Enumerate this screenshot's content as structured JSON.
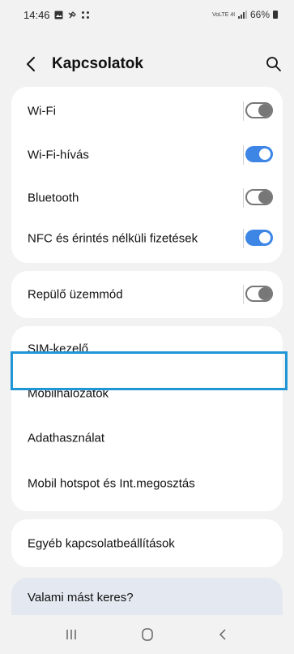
{
  "status_bar": {
    "time": "14:46",
    "network_small": "VoLTE 4G LTE1",
    "battery": "66%"
  },
  "app_bar": {
    "title": "Kapcsolatok"
  },
  "group1": {
    "items": [
      {
        "label": "Wi-Fi",
        "toggle": "off"
      },
      {
        "label": "Wi-Fi-hívás",
        "toggle": "on"
      },
      {
        "label": "Bluetooth",
        "toggle": "off"
      },
      {
        "label": "NFC és érintés nélküli fizetések",
        "toggle": "on"
      }
    ]
  },
  "group2": {
    "items": [
      {
        "label": "Repülő üzemmód",
        "toggle": "off"
      }
    ]
  },
  "group3": {
    "items": [
      {
        "label": "SIM-kezelő"
      },
      {
        "label": "Mobilhálózatok"
      },
      {
        "label": "Adathasználat"
      },
      {
        "label": "Mobil hotspot és Int.megosztás"
      }
    ]
  },
  "group4": {
    "items": [
      {
        "label": "Egyéb kapcsolatbeállítások"
      }
    ]
  },
  "suggestion": {
    "label": "Valami mást keres?"
  },
  "colors": {
    "accent": "#3d86e6",
    "highlight": "#2196d6"
  }
}
